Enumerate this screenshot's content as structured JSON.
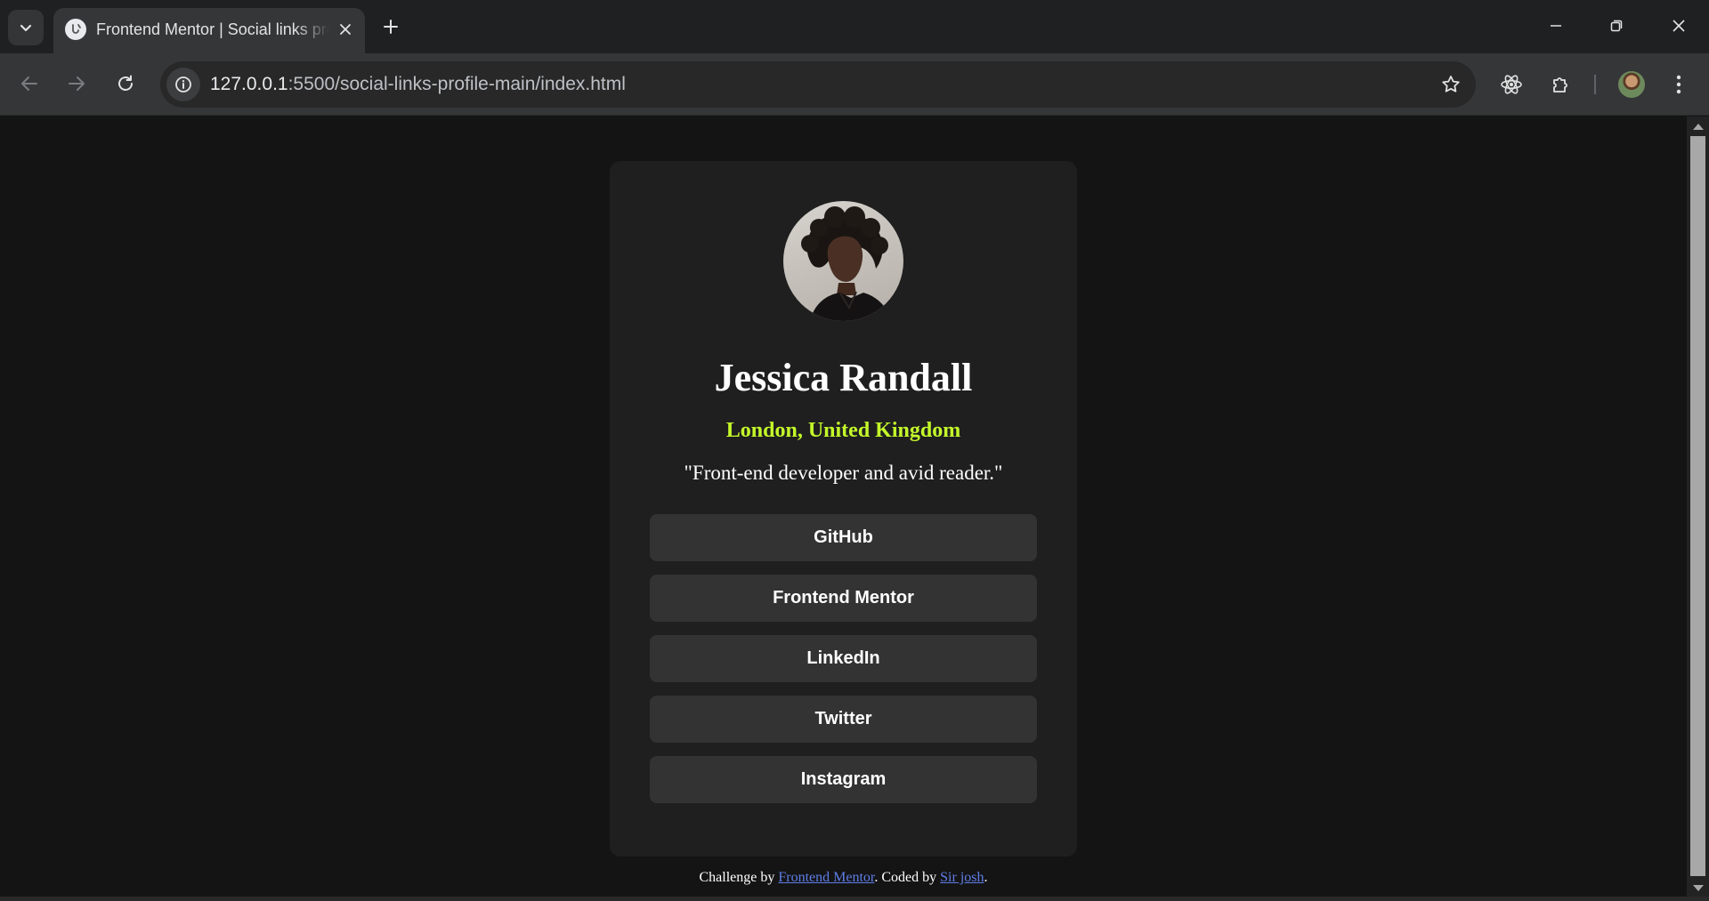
{
  "browser": {
    "tab_title": "Frontend Mentor | Social links profile",
    "url_host": "127.0.0.1",
    "url_rest": ":5500/social-links-profile-main/index.html"
  },
  "profile": {
    "name": "Jessica Randall",
    "location": "London, United Kingdom",
    "bio": "\"Front-end developer and avid reader.\"",
    "links": [
      "GitHub",
      "Frontend Mentor",
      "LinkedIn",
      "Twitter",
      "Instagram"
    ]
  },
  "footer": {
    "prefix": "Challenge by ",
    "challenge_link": "Frontend Mentor",
    "middle": ". Coded by ",
    "author_link": "Sir josh",
    "suffix": "."
  },
  "colors": {
    "page_bg": "#141414",
    "card_bg": "#1f1f1f",
    "button_bg": "#333333",
    "accent_green": "#c4f82a",
    "link_blue": "#5f7ee8"
  },
  "icons": [
    "tab-search-icon",
    "favicon-icon",
    "close-icon",
    "plus-icon",
    "minimize-icon",
    "restore-icon",
    "window-close-icon",
    "back-arrow-icon",
    "forward-arrow-icon",
    "reload-icon",
    "info-icon",
    "star-icon",
    "react-icon",
    "puzzle-icon",
    "kebab-menu-icon"
  ]
}
